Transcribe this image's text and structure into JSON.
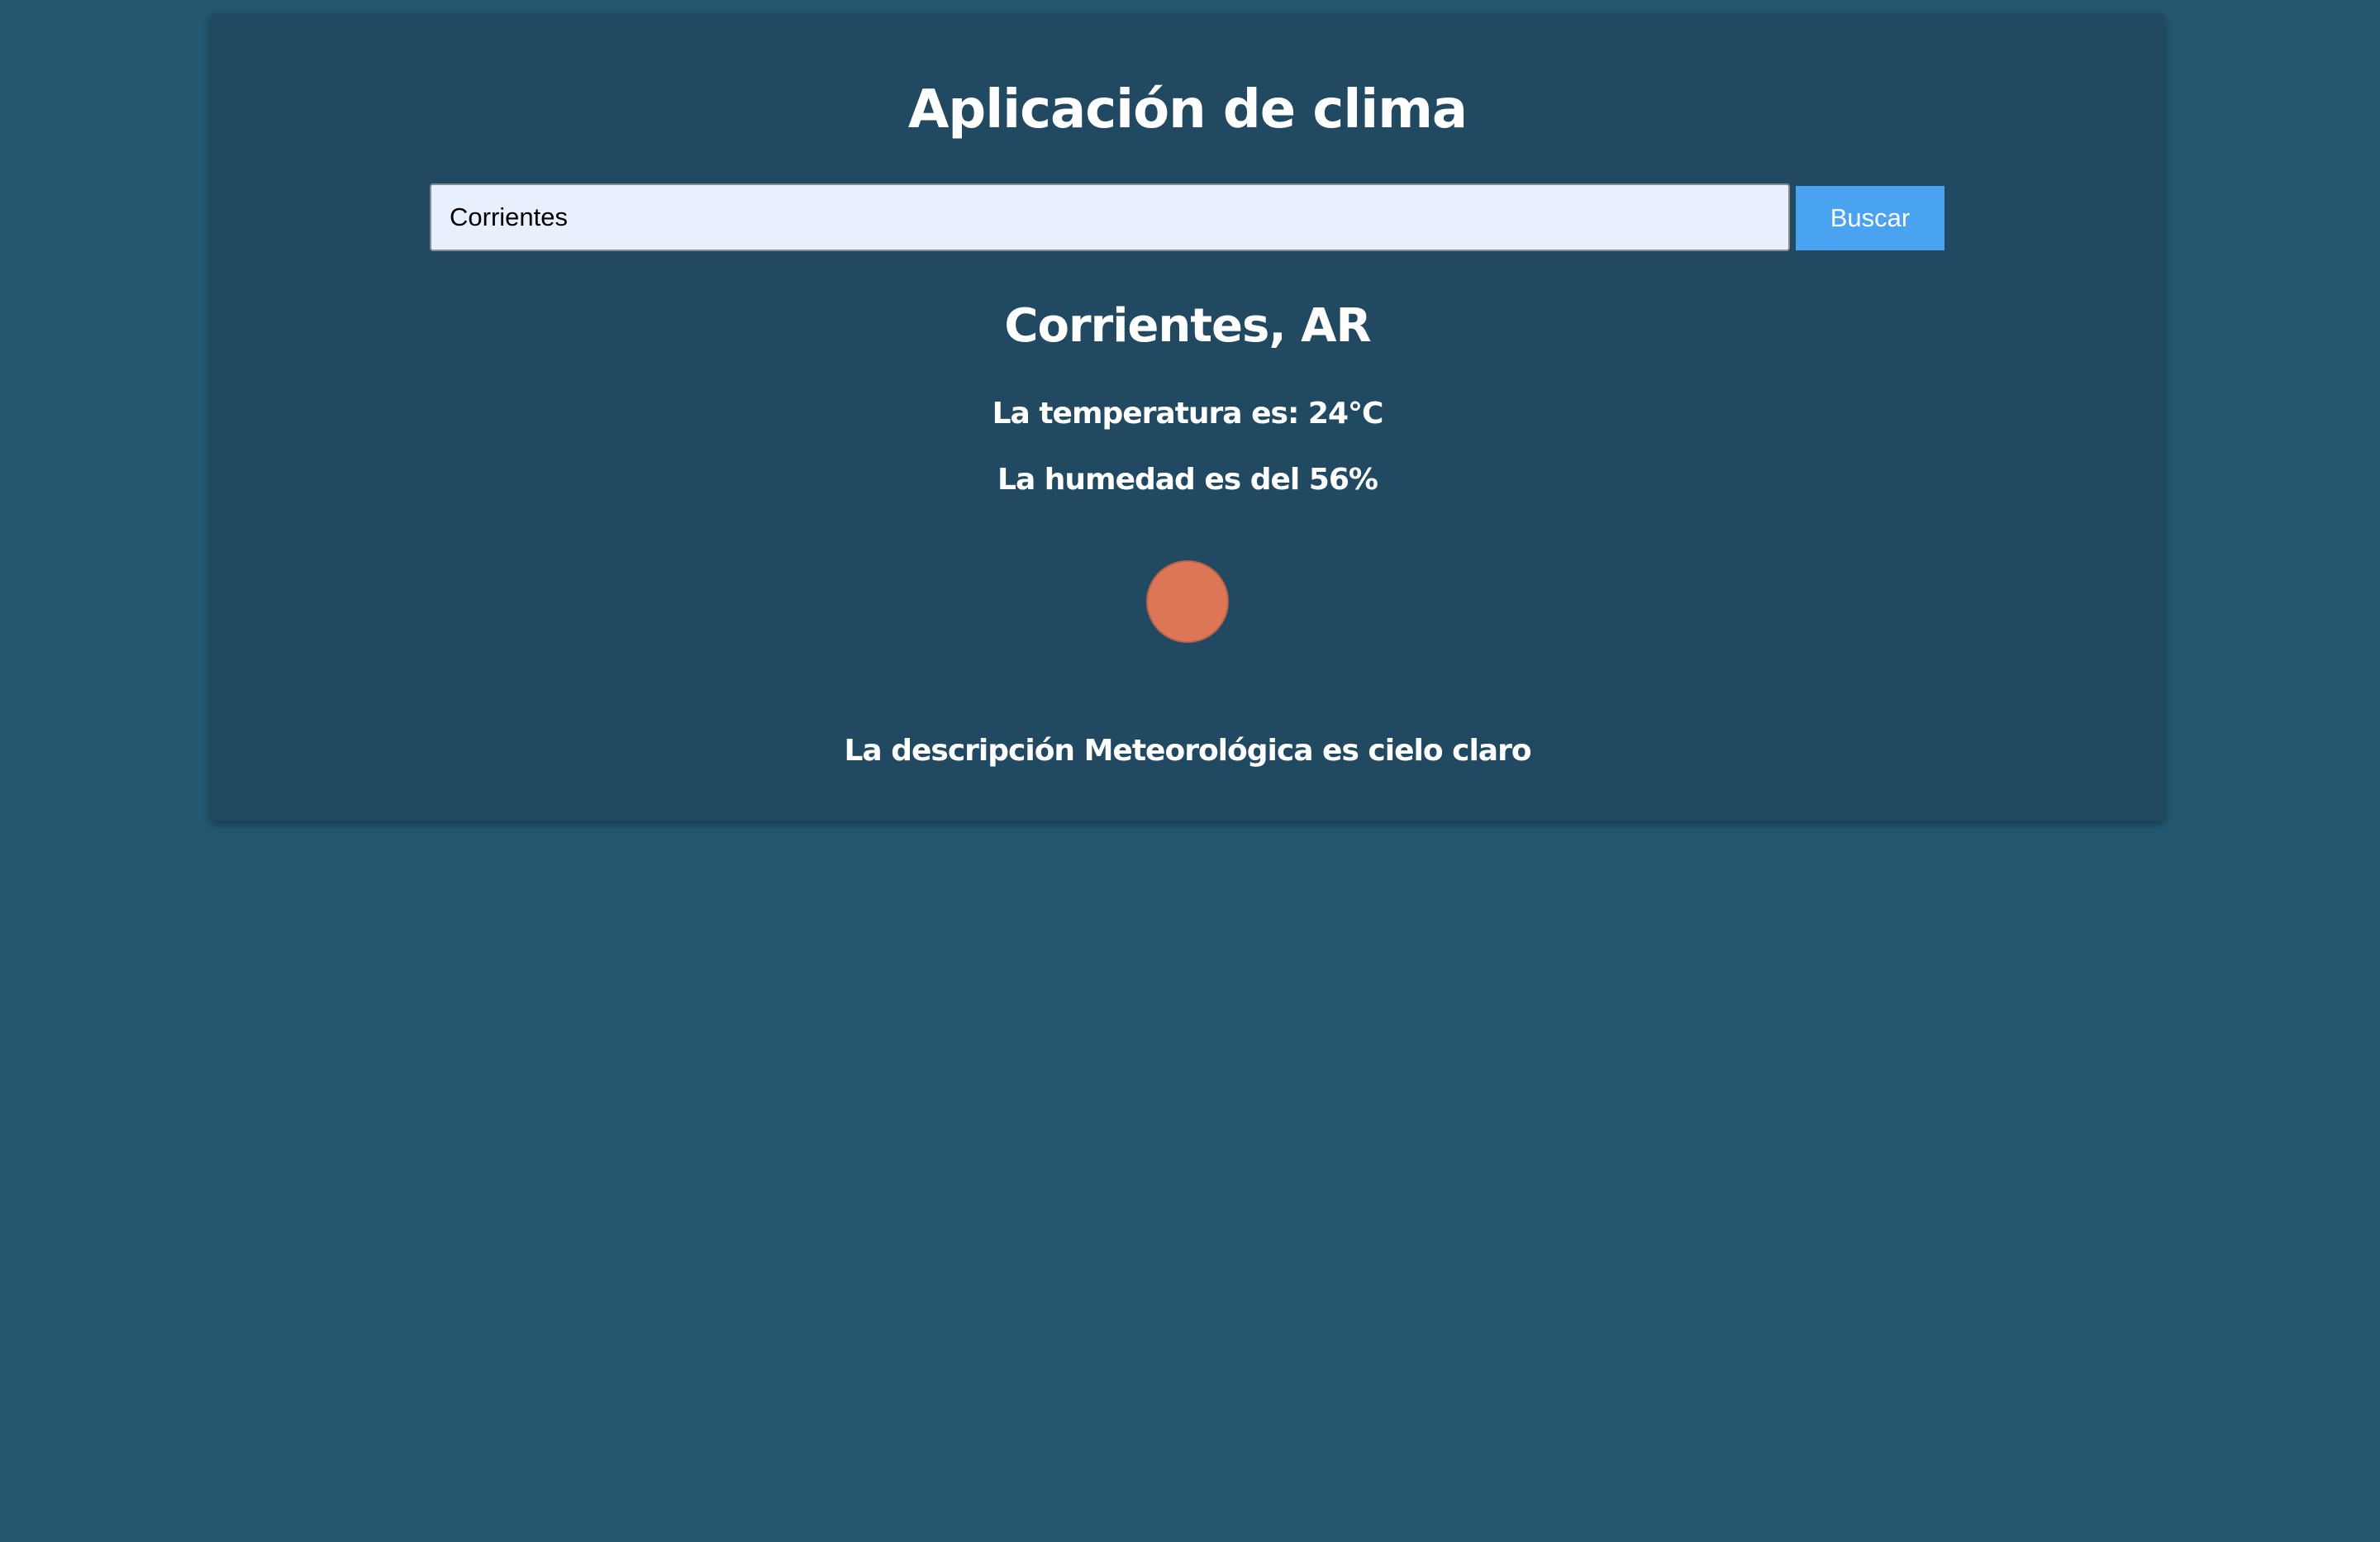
{
  "app": {
    "title": "Aplicación de clima"
  },
  "search": {
    "value": "Corrientes",
    "button_label": "Buscar"
  },
  "weather": {
    "location": "Corrientes, AR",
    "temperature_text": "La temperatura es: 24°C",
    "humidity_text": "La humedad es del 56%",
    "icon": "sun-icon",
    "description_text": "La descripción Meteorológica es cielo claro"
  },
  "colors": {
    "page_background": "#245770",
    "card_background": "#214a62",
    "button": "#4aa3f0",
    "input_background": "#e8f0fe",
    "sun": "#dd7656"
  }
}
